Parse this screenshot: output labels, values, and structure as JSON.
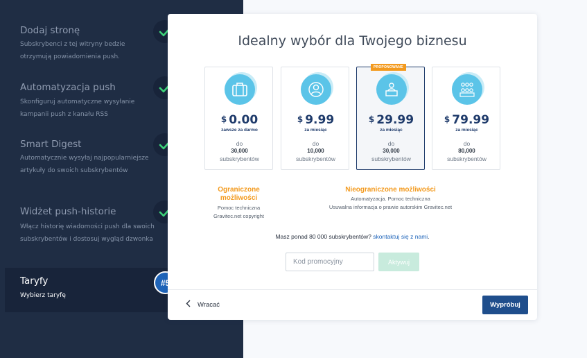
{
  "sidebar": {
    "steps": [
      {
        "title": "Dodaj stronę",
        "desc": "Subskrybenci z tej witryny bedzie otrzymują powiadomienia push."
      },
      {
        "title": "Automatyzacja push",
        "desc": "Skonfiguruj automatyczne wysyłanie kampanii push z kanału RSS"
      },
      {
        "title": "Smart Digest",
        "desc": "Automatycznie wysyłaj najpopularniejsze artykuły do swoich subskrybentów"
      },
      {
        "title": "Widżet push-historie",
        "desc": "Włącz historię wiadomości push dla swoich subskrybentów i dostosuj wygląd dzwonka"
      }
    ],
    "active": {
      "title": "Taryfy",
      "desc": "Wybierz taryfę",
      "badge": "#5"
    }
  },
  "main": {
    "title": "Idealny wybór dla Twojego biznesu",
    "plans": [
      {
        "currency": "$",
        "price": "0.00",
        "period": "zawsze za darmo",
        "do": "do",
        "count": "30,000",
        "unit": "subskrybentów",
        "icon": "briefcase-icon"
      },
      {
        "currency": "$",
        "price": "9.99",
        "period": "za miesiąc",
        "do": "do",
        "count": "10,000",
        "unit": "subskrybentów",
        "icon": "person-icon"
      },
      {
        "currency": "$",
        "price": "29.99",
        "period": "za miesiąc",
        "do": "do",
        "count": "30,000",
        "unit": "subskrybentów",
        "icon": "team-icon",
        "badge": "PROPONOWANE",
        "selected": true
      },
      {
        "currency": "$",
        "price": "79.99",
        "period": "za miesiąc",
        "do": "do",
        "count": "80,000",
        "unit": "subskrybentów",
        "icon": "group-icon"
      }
    ],
    "limited": {
      "title_line1": "Ograniczone",
      "title_line2": "możliwości",
      "line1": "Pomoc techniczna",
      "line2": "Gravitec.net copyright"
    },
    "unlimited": {
      "title": "Nieograniczone możliwości",
      "line1": "Automatyzacja. Pomoc techniczna",
      "line2": "Usuwalna informacja o prawie autorskim Gravitec.net"
    },
    "contact_text": "Masz ponad 80 000 subskrybentów? ",
    "contact_link": "skontaktuj się z nami",
    "contact_end": ".",
    "promo": {
      "placeholder": "Kod promocyjny",
      "value": "",
      "button": "Aktywuj"
    },
    "footer": {
      "back": "Wracać",
      "submit": "Wypróbuj"
    }
  },
  "colors": {
    "sidebar_bg": "#1f2d44",
    "check": "#3dd47a",
    "accent_orange": "#f39a1e",
    "primary": "#1f4e8c",
    "icon_bg": "#5bc4e8"
  }
}
